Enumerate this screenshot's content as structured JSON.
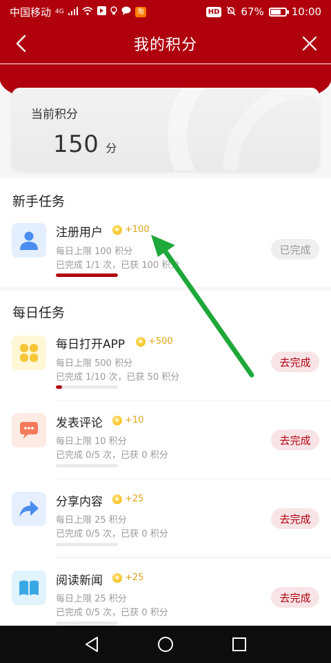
{
  "status_bar": {
    "carrier": "中国移动",
    "network": "4G",
    "battery": "67%",
    "time": "10:00",
    "hd_badge": "HD",
    "tao_badge": "淘"
  },
  "header": {
    "title": "我的积分",
    "back_icon": "chevron-left-icon",
    "close_icon": "close-icon"
  },
  "points": {
    "label": "当前积分",
    "value": "150",
    "unit": "分"
  },
  "newbie": {
    "title": "新手任务",
    "tasks": [
      {
        "name": "注册用户",
        "reward": "+100",
        "limit": "每日上限 100 积分",
        "progress_text": "已完成 1/1 次，已获 100 积分",
        "progress": 1.0,
        "button": "已完成",
        "icon": "user-icon"
      }
    ]
  },
  "daily": {
    "title": "每日任务",
    "tasks": [
      {
        "name": "每日打开APP",
        "reward": "+500",
        "limit": "每日上限 500 积分",
        "progress_text": "已完成 1/10 次，已获 50 积分",
        "progress": 0.1,
        "button": "去完成",
        "icon": "grid-flower-icon"
      },
      {
        "name": "发表评论",
        "reward": "+10",
        "limit": "每日上限 10 积分",
        "progress_text": "已完成 0/5 次，已获 0 积分",
        "progress": 0,
        "button": "去完成",
        "icon": "comment-icon"
      },
      {
        "name": "分享内容",
        "reward": "+25",
        "limit": "每日上限 25 积分",
        "progress_text": "已完成 0/5 次，已获 0 积分",
        "progress": 0,
        "button": "去完成",
        "icon": "share-icon"
      },
      {
        "name": "阅读新闻",
        "reward": "+25",
        "limit": "每日上限 25 积分",
        "progress_text": "已完成 0/5 次，已获 0 积分",
        "progress": 0,
        "button": "去完成",
        "icon": "book-icon"
      }
    ]
  },
  "colors": {
    "brand_red": "#b0000e",
    "coin_gold": "#f4b400",
    "annotation_arrow": "#1fa83a"
  }
}
